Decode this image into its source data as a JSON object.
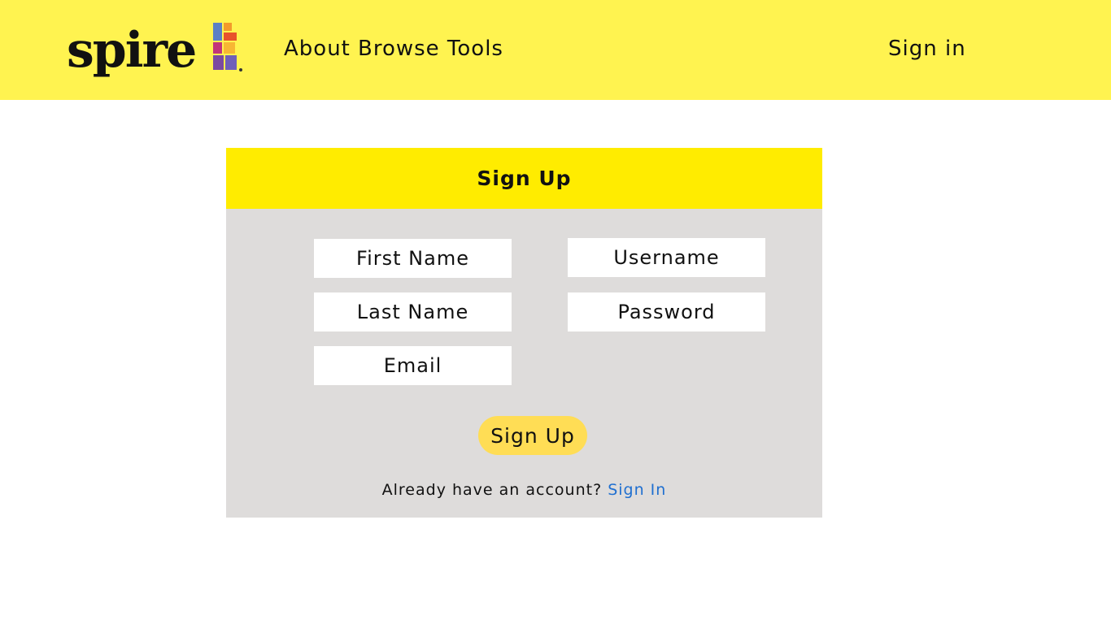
{
  "header": {
    "logo_text": "spire",
    "nav": {
      "about": "About",
      "browse_tools": "Browse Tools",
      "sign_in": "Sign in"
    }
  },
  "signup_form": {
    "title": "Sign Up",
    "fields": {
      "first_name": {
        "value": "",
        "placeholder": "First Name"
      },
      "last_name": {
        "value": "",
        "placeholder": "Last Name"
      },
      "email": {
        "value": "",
        "placeholder": "Email"
      },
      "username": {
        "value": "",
        "placeholder": "Username"
      },
      "password": {
        "value": "",
        "placeholder": "Password"
      }
    },
    "submit_label": "Sign Up",
    "account_prompt": "Already have an account?",
    "signin_link": "Sign In"
  },
  "colors": {
    "header_bg": "#fff350",
    "card_header_bg": "#ffec00",
    "card_bg": "#dedcdb",
    "button_bg": "#ffdd55",
    "link": "#1f6fd0"
  },
  "icons": {
    "logo_mark": "spire-stained-glass-logo-icon"
  }
}
